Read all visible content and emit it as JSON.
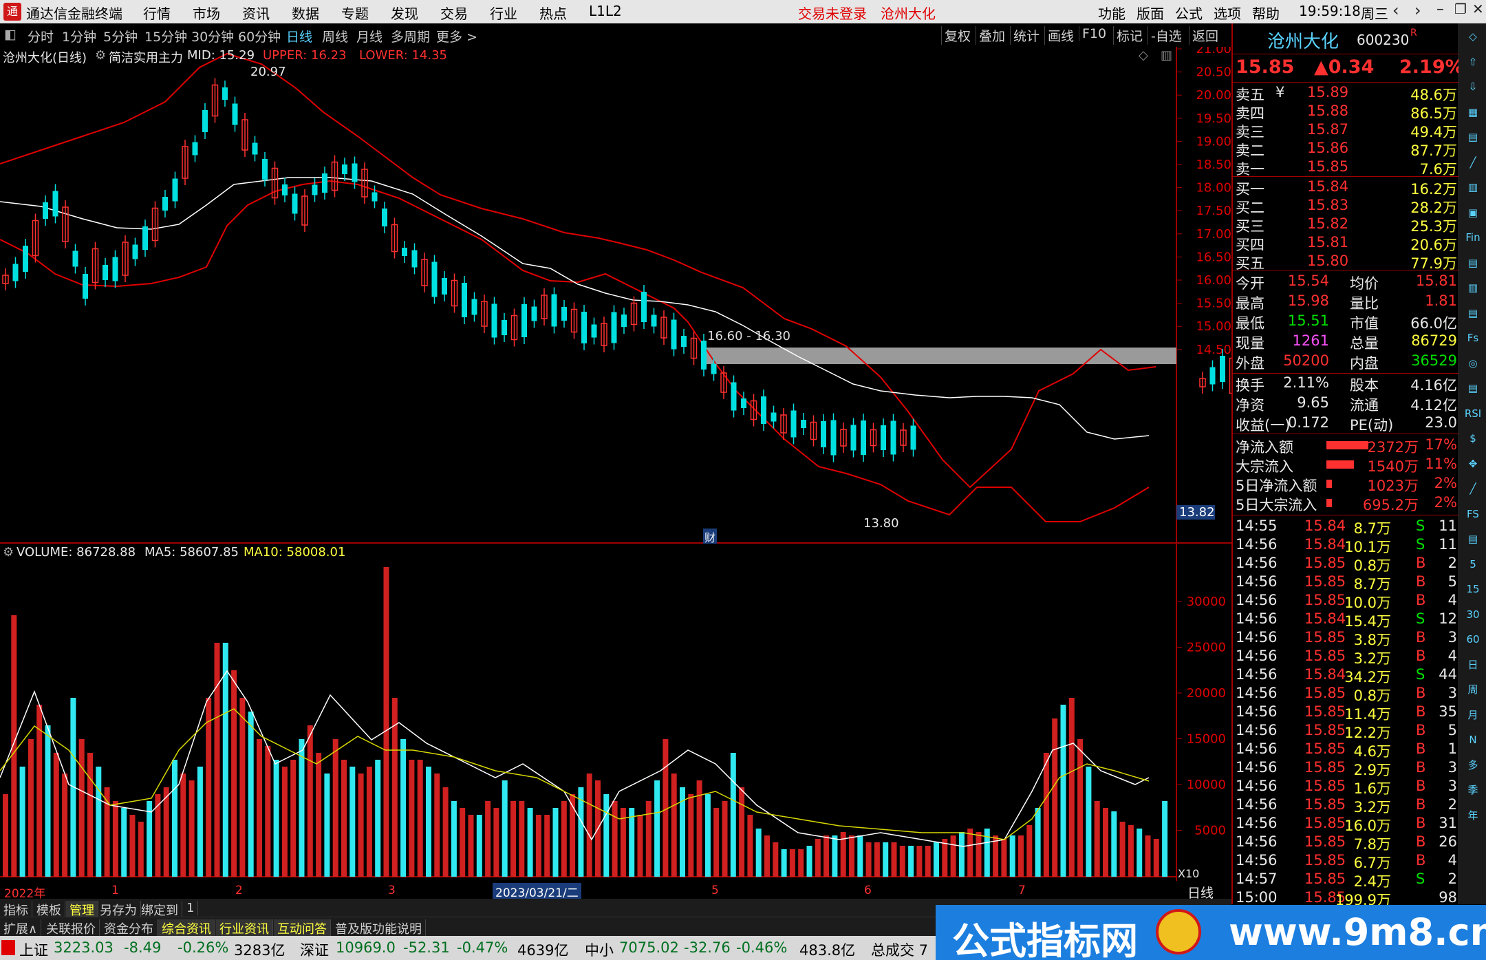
{
  "titlebar": {
    "app_title": "通达信金融终端",
    "menus": [
      "行情",
      "市场",
      "资讯",
      "数据",
      "专题",
      "发现",
      "交易",
      "行业",
      "热点",
      "L1L2"
    ],
    "login_status": "交易未登录",
    "stock_title": "沧州大化",
    "right_menus": [
      "功能",
      "版面",
      "公式",
      "选项",
      "帮助"
    ],
    "clock": "19:59:18",
    "weekday": "周三"
  },
  "toolbar": {
    "periods": [
      "分时",
      "1分钟",
      "5分钟",
      "15分钟",
      "30分钟",
      "60分钟",
      "日线",
      "周线",
      "月线",
      "多周期",
      "更多 >"
    ],
    "active_period": "日线",
    "right_buttons": [
      "复权",
      "叠加",
      "统计",
      "画线",
      "F10",
      "标记",
      "-自选",
      "返回"
    ]
  },
  "main_chart": {
    "info": {
      "name": "沧州大化(日线)",
      "indicator": "简洁实用主力",
      "mid": "MID: 15.29",
      "upper": "UPPER: 16.23",
      "lower": "LOWER: 14.35"
    },
    "y_ticks": [
      "21.00",
      "20.50",
      "20.00",
      "19.50",
      "19.00",
      "18.50",
      "18.00",
      "17.50",
      "17.00",
      "16.50",
      "16.00",
      "15.50",
      "15.00",
      "14.50"
    ],
    "current_price_tag": "13.82",
    "high_label": "20.97",
    "low_label": "13.80",
    "zone_label": "16.60 - 16.30",
    "fin_marker": "财"
  },
  "vol_chart": {
    "info": {
      "volume": "VOLUME: 86728.88",
      "ma5": "MA5: 58607.85",
      "ma10": "MA10: 58008.01"
    },
    "y_ticks": [
      "30000",
      "25000",
      "20000",
      "15000",
      "10000",
      "5000"
    ],
    "unit": "X10",
    "x_labels": [
      "2022年",
      "1",
      "2",
      "3",
      "5",
      "6",
      "7"
    ],
    "cursor_date": "2023/03/21/二",
    "period_label": "日线"
  },
  "quote": {
    "name": "沧州大化",
    "code": "600230",
    "flag": "R",
    "price": "15.85",
    "change": "▲0.34",
    "pct": "2.19%",
    "asks": [
      {
        "label": "卖五",
        "price": "15.89",
        "vol": "48.6万"
      },
      {
        "label": "卖四",
        "price": "15.88",
        "vol": "86.5万"
      },
      {
        "label": "卖三",
        "price": "15.87",
        "vol": "49.4万"
      },
      {
        "label": "卖二",
        "price": "15.86",
        "vol": "87.7万"
      },
      {
        "label": "卖一",
        "price": "15.85",
        "vol": "7.6万"
      }
    ],
    "ask_currency": "¥",
    "bids": [
      {
        "label": "买一",
        "price": "15.84",
        "vol": "16.2万"
      },
      {
        "label": "买二",
        "price": "15.83",
        "vol": "28.2万"
      },
      {
        "label": "买三",
        "price": "15.82",
        "vol": "25.3万"
      },
      {
        "label": "买四",
        "price": "15.81",
        "vol": "20.6万"
      },
      {
        "label": "买五",
        "price": "15.80",
        "vol": "77.9万"
      }
    ],
    "stats1": [
      {
        "l1": "今开",
        "v1": "15.54",
        "l2": "均价",
        "v2": "15.81"
      },
      {
        "l1": "最高",
        "v1": "15.98",
        "l2": "量比",
        "v2": "1.81"
      },
      {
        "l1": "最低",
        "v1": "15.51",
        "l2": "市值",
        "v2": "66.0亿"
      },
      {
        "l1": "现量",
        "v1": "1261",
        "l2": "总量",
        "v2": "86729"
      },
      {
        "l1": "外盘",
        "v1": "50200",
        "l2": "内盘",
        "v2": "36529"
      }
    ],
    "stats2": [
      {
        "l1": "换手",
        "v1": "2.11%",
        "l2": "股本",
        "v2": "4.16亿"
      },
      {
        "l1": "净资",
        "v1": "9.65",
        "l2": "流通",
        "v2": "4.12亿"
      },
      {
        "l1": "收益(一)",
        "v1": "0.172",
        "l2": "PE(动)",
        "v2": "23.0"
      }
    ],
    "flows": [
      {
        "label": "净流入额",
        "value": "2372万",
        "pct": "17%",
        "bar": 0.17
      },
      {
        "label": "大宗流入",
        "value": "1540万",
        "pct": "11%",
        "bar": 0.11
      },
      {
        "label": "5日净流入额",
        "value": "1023万",
        "pct": "2%",
        "bar": 0.02
      },
      {
        "label": "5日大宗流入",
        "value": "695.2万",
        "pct": "2%",
        "bar": 0.02
      }
    ],
    "ticks": [
      {
        "t": "14:55",
        "p": "15.84",
        "v": "8.7万",
        "s": "S",
        "n": "11"
      },
      {
        "t": "14:56",
        "p": "15.84",
        "v": "10.1万",
        "s": "S",
        "n": "11"
      },
      {
        "t": "14:56",
        "p": "15.85",
        "v": "0.8万",
        "s": "B",
        "n": "2"
      },
      {
        "t": "14:56",
        "p": "15.85",
        "v": "8.7万",
        "s": "B",
        "n": "5"
      },
      {
        "t": "14:56",
        "p": "15.85",
        "v": "10.0万",
        "s": "B",
        "n": "4"
      },
      {
        "t": "14:56",
        "p": "15.84",
        "v": "15.4万",
        "s": "S",
        "n": "12"
      },
      {
        "t": "14:56",
        "p": "15.85",
        "v": "3.8万",
        "s": "B",
        "n": "3"
      },
      {
        "t": "14:56",
        "p": "15.85",
        "v": "3.2万",
        "s": "B",
        "n": "4"
      },
      {
        "t": "14:56",
        "p": "15.84",
        "v": "34.2万",
        "s": "S",
        "n": "44"
      },
      {
        "t": "14:56",
        "p": "15.85",
        "v": "0.8万",
        "s": "B",
        "n": "3"
      },
      {
        "t": "14:56",
        "p": "15.85",
        "v": "11.4万",
        "s": "B",
        "n": "35"
      },
      {
        "t": "14:56",
        "p": "15.85",
        "v": "12.2万",
        "s": "B",
        "n": "5"
      },
      {
        "t": "14:56",
        "p": "15.85",
        "v": "4.6万",
        "s": "B",
        "n": "1"
      },
      {
        "t": "14:56",
        "p": "15.85",
        "v": "2.9万",
        "s": "B",
        "n": "3"
      },
      {
        "t": "14:56",
        "p": "15.85",
        "v": "1.6万",
        "s": "B",
        "n": "3"
      },
      {
        "t": "14:56",
        "p": "15.85",
        "v": "3.2万",
        "s": "B",
        "n": "2"
      },
      {
        "t": "14:56",
        "p": "15.85",
        "v": "16.0万",
        "s": "B",
        "n": "31"
      },
      {
        "t": "14:56",
        "p": "15.85",
        "v": "7.8万",
        "s": "B",
        "n": "26"
      },
      {
        "t": "14:56",
        "p": "15.85",
        "v": "6.7万",
        "s": "B",
        "n": "4"
      },
      {
        "t": "14:57",
        "p": "15.85",
        "v": "2.4万",
        "s": "S",
        "n": "2"
      },
      {
        "t": "15:00",
        "p": "15.85",
        "v": "199.9万",
        "s": "",
        "n": "98"
      }
    ]
  },
  "sidebar_icons": [
    "◇",
    "⇧",
    "⇩",
    "▦",
    "▤",
    "╱",
    "▥",
    "▣",
    "Fin",
    "▤",
    "▥",
    "▤",
    "Fs",
    "◎",
    "▤",
    "RSI",
    "$",
    "✥",
    "╱",
    "FS",
    "▤",
    "5",
    "15",
    "30",
    "60",
    "日",
    "周",
    "月",
    "N",
    "多",
    "季",
    "年"
  ],
  "tabs1": [
    "指标",
    "模板",
    "管理",
    "另存为",
    "绑定到",
    "1"
  ],
  "tabs1_active": "管理",
  "tabs2": [
    "扩展∧",
    "关联报价",
    "资金分布",
    "综合资讯",
    "行业资讯",
    "互动问答",
    "普及版功能说明"
  ],
  "status": {
    "sh_name": "上证",
    "sh_val": "3223.03",
    "sh_chg": "-8.49",
    "sh_pct": "-0.26%",
    "sh_amt": "3283亿",
    "sz_name": "深证",
    "sz_val": "10969.0",
    "sz_chg": "-52.31",
    "sz_pct": "-0.47%",
    "sz_amt": "4639亿",
    "zx_name": "中小",
    "zx_val": "7075.02",
    "zx_chg": "-32.76",
    "zx_pct": "-0.46%",
    "zx_amt": "483.8亿",
    "total": "总成交 7"
  },
  "banner": {
    "left": "公式指标网",
    "right": "www.9m8.cn"
  },
  "colors": {
    "up": "#ff3030",
    "down": "#00e0e0",
    "mid_line": "#ffffff",
    "band": "#e00000",
    "ma10": "#d8d800"
  }
}
